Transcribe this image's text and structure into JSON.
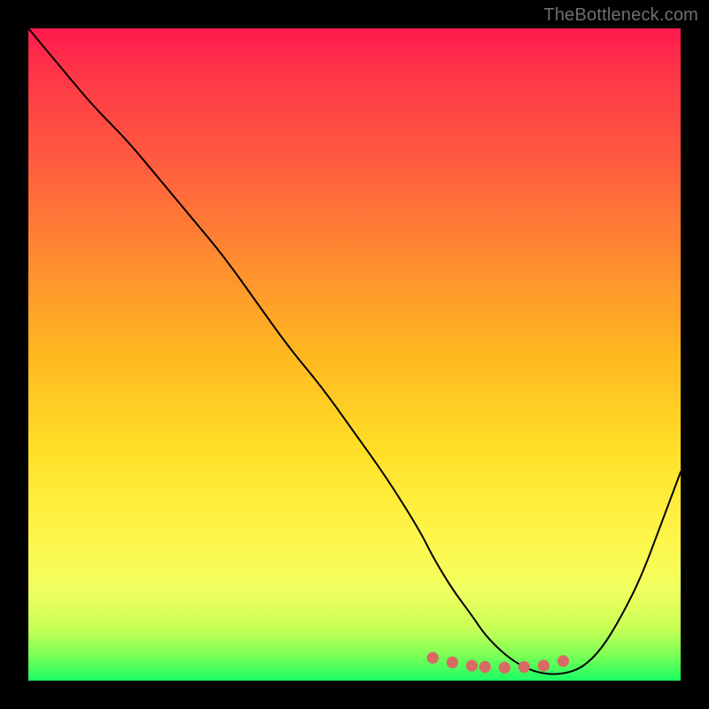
{
  "watermark": "TheBottleneck.com",
  "chart_data": {
    "type": "line",
    "title": "",
    "xlabel": "",
    "ylabel": "",
    "xlim": [
      0,
      100
    ],
    "ylim": [
      0,
      100
    ],
    "grid": false,
    "legend": false,
    "gradient_colors_top_to_bottom": [
      "#ff1a4d",
      "#ff5a40",
      "#ffb820",
      "#fff54a",
      "#1aff63"
    ],
    "series": [
      {
        "name": "bottleneck-curve",
        "x": [
          0,
          5,
          10,
          15,
          20,
          25,
          30,
          35,
          40,
          45,
          50,
          55,
          60,
          62,
          65,
          68,
          70,
          73,
          76,
          79,
          82,
          85,
          88,
          91,
          94,
          97,
          100
        ],
        "values": [
          100,
          94,
          88,
          83,
          77,
          71,
          65,
          58,
          51,
          45,
          38,
          31,
          23,
          19,
          14,
          10,
          7,
          4,
          2,
          1,
          1,
          2,
          5,
          10,
          16,
          24,
          32
        ]
      }
    ],
    "markers": {
      "name": "optimal-range-beads",
      "x": [
        62,
        65,
        68,
        70,
        73,
        76,
        79,
        82
      ],
      "values": [
        3.5,
        2.8,
        2.3,
        2.1,
        2.0,
        2.1,
        2.3,
        3.0
      ],
      "color": "#d86a64"
    }
  }
}
